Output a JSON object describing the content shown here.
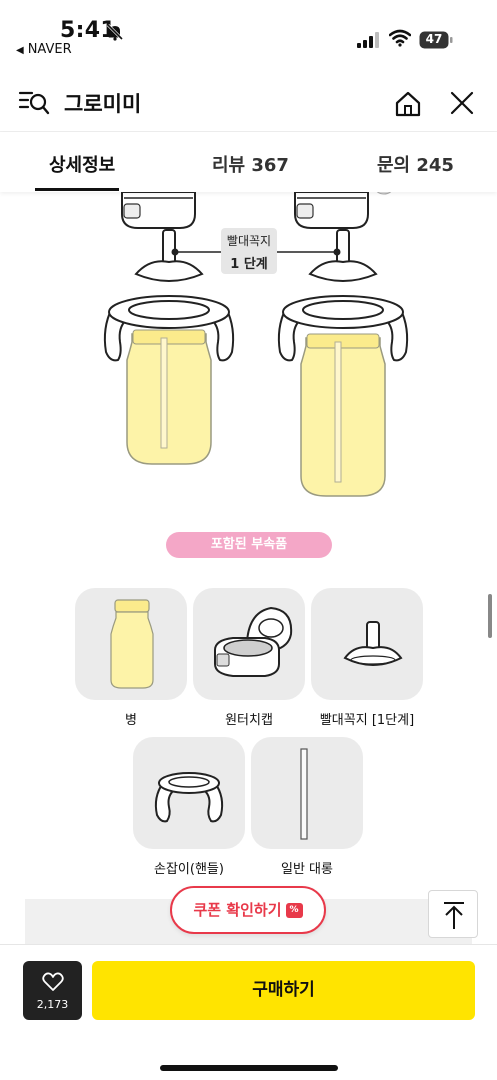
{
  "status_bar": {
    "time": "5:41",
    "back_app": "NAVER",
    "battery": "47"
  },
  "header": {
    "title": "그로미미"
  },
  "tabs": [
    {
      "label": "상세정보",
      "active": true
    },
    {
      "label": "리뷰 367",
      "active": false
    },
    {
      "label": "문의 245",
      "active": false
    }
  ],
  "diagram": {
    "callout_line1": "빨대꼭지",
    "callout_line2": "1 단계"
  },
  "included_label": "포함된 부속품",
  "accessories": [
    {
      "label": "병",
      "icon": "bottle-icon"
    },
    {
      "label": "원터치캡",
      "icon": "one-touch-cap-icon"
    },
    {
      "label": "빨대꼭지 [1단계]",
      "icon": "straw-nipple-icon"
    },
    {
      "label": "손잡이(핸들)",
      "icon": "handle-icon"
    },
    {
      "label": "일반 대롱",
      "icon": "straw-tube-icon"
    }
  ],
  "coupon": {
    "label": "쿠폰 확인하기",
    "badge": "%"
  },
  "bottom_bar": {
    "like_count": "2,173",
    "buy_label": "구매하기"
  },
  "colors": {
    "accent_yellow": "#ffe400",
    "coupon_red": "#e8394a",
    "pill_pink": "#f4a7c7",
    "bottle_yellow": "#fdf3a8"
  }
}
